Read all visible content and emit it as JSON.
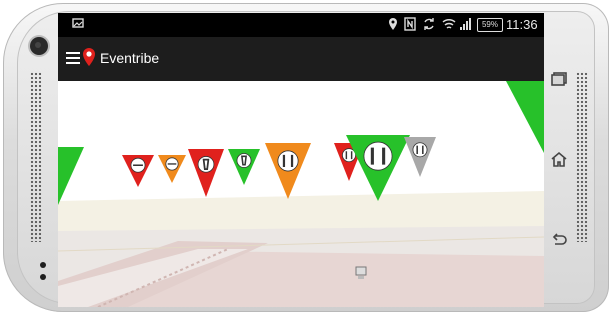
{
  "status_bar": {
    "time": "11:36",
    "battery": "59%"
  },
  "toolbar": {
    "title": "Eventribe"
  },
  "colors": {
    "red": "#e0211d",
    "orange": "#f08a1c",
    "green": "#27c12a",
    "gray": "#a8a8a8"
  },
  "ar_markers": [
    {
      "color": "red",
      "icon": "sausage-icon"
    },
    {
      "color": "orange",
      "icon": "sausage-icon"
    },
    {
      "color": "red",
      "icon": "drink-icon"
    },
    {
      "color": "green",
      "icon": "drink-icon"
    },
    {
      "color": "orange",
      "icon": "cutlery-icon"
    },
    {
      "color": "red",
      "icon": "cutlery-icon"
    },
    {
      "color": "green",
      "icon": "cutlery-icon"
    },
    {
      "color": "gray",
      "icon": "cutlery-icon"
    }
  ],
  "nav_buttons": [
    "recent-apps-icon",
    "home-icon",
    "back-icon"
  ]
}
